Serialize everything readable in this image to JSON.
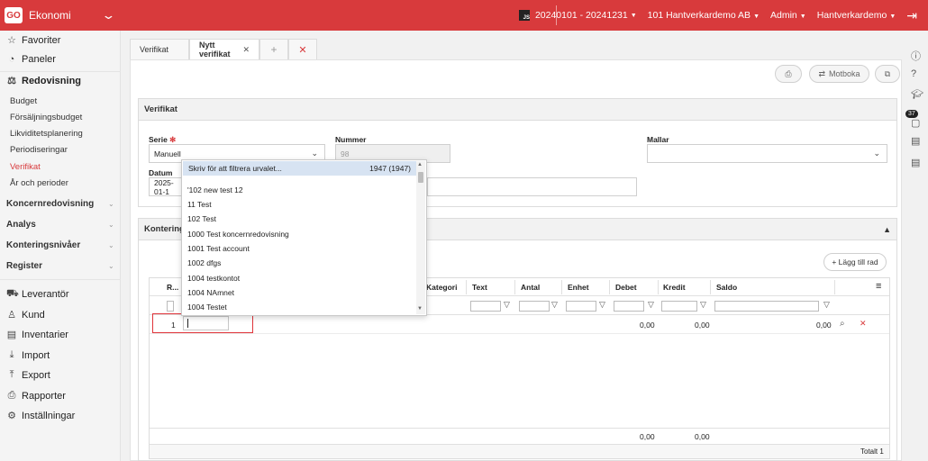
{
  "topbar": {
    "logo": "GO",
    "app_name": "Ekonomi",
    "js_badge": "JS",
    "period": "20240101 - 20241231",
    "company": "101 Hantverkardemo AB",
    "user": "Admin",
    "role": "Hantverkardemo"
  },
  "sidebar": {
    "favoriter": "Favoriter",
    "paneler": "Paneler",
    "redovisning": "Redovisning",
    "sub": [
      "Budget",
      "Försäljningsbudget",
      "Likviditetsplanering",
      "Periodiseringar",
      "Verifikat",
      "År och perioder"
    ],
    "groups": [
      "Koncernredovisning",
      "Analys",
      "Konteringsnivåer",
      "Register"
    ],
    "modules": [
      "Leverantör",
      "Kund",
      "Inventarier",
      "Import",
      "Export",
      "Rapporter",
      "Inställningar"
    ]
  },
  "rail": {
    "badge": "37"
  },
  "tabs": {
    "first": "Verifikat",
    "second": "Nytt verifikat"
  },
  "toolbar": {
    "motboka": "Motboka"
  },
  "verifikat": {
    "title": "Verifikat",
    "serie_label": "Serie",
    "serie_value": "Manuell",
    "nummer_label": "Nummer",
    "nummer_value": "98",
    "mallar_label": "Mallar",
    "datum_label": "Datum",
    "datum_value": "2025-01-1"
  },
  "kontering": {
    "title": "Konteringsr",
    "add_row": "+ Lägg till rad",
    "headers": {
      "r": "R...",
      "kategori": "Kategori",
      "text": "Text",
      "antal": "Antal",
      "enhet": "Enhet",
      "debet": "Debet",
      "kredit": "Kredit",
      "saldo": "Saldo"
    },
    "row": {
      "num": "1",
      "debet": "0,00",
      "kredit": "0,00",
      "saldo": "0,00"
    },
    "footer": {
      "debet": "0,00",
      "kredit": "0,00"
    },
    "total": "Totalt 1"
  },
  "dropdown": {
    "filter_placeholder": "Skriv för att filtrera urvalet...",
    "count": "1947 (1947)",
    "items": [
      "'102 new test 12",
      "11 Test",
      "102 Test",
      "1000 Test koncernredovisning",
      "1001 Test account",
      "1002 dfgs",
      "1004 testkontot",
      "1004 NAmnet",
      "1004 Testet"
    ]
  },
  "colors": {
    "brand": "#d83a3c",
    "highlight": "#e0343a",
    "dropdown_selected": "#d7e3f2"
  }
}
